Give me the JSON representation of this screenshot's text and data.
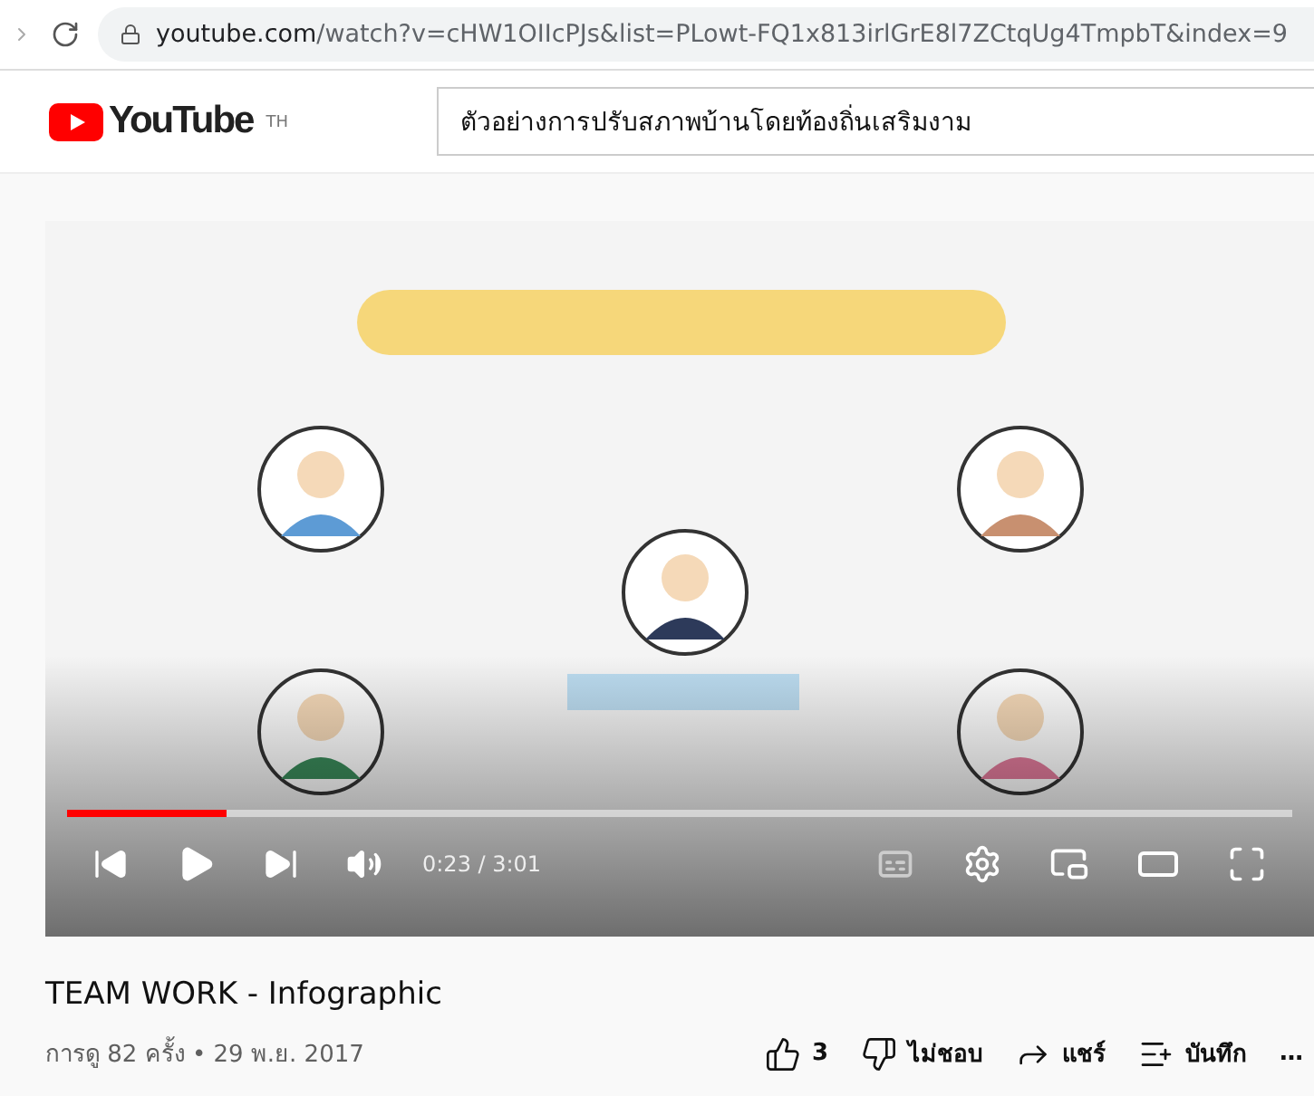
{
  "browser": {
    "url_host": "youtube.com",
    "url_path": "/watch?v=cHW1OIIcPJs&list=PLowt-FQ1x813irlGrE8l7ZCtqUg4TmpbT&index=9"
  },
  "header": {
    "logo": "YouTube",
    "region": "TH",
    "search_value": "ตัวอย่างการปรับสภาพบ้านโดยท้องถิ่นเสริมงาม"
  },
  "player": {
    "kind": "picture",
    "progress": {
      "level": 0.13
    },
    "time": "0:23 / 3:01"
  },
  "video": {
    "title": "TEAM WORK - Infographic",
    "meta": "การดู 82 ครั้ง • 29 พ.ย. 2017",
    "actions": [
      {
        "kind": "like",
        "label": "3"
      },
      {
        "kind": "dislike",
        "label": "ไม่ชอบ"
      },
      {
        "kind": "share",
        "label": "แชร์"
      },
      {
        "kind": "save",
        "label": "บันทึก"
      },
      {
        "kind": "more",
        "label": "…"
      }
    ]
  }
}
